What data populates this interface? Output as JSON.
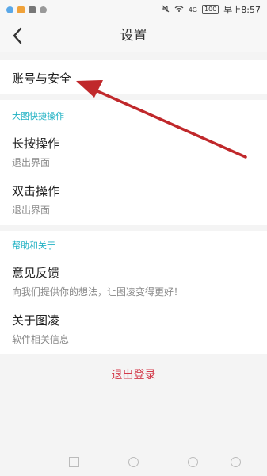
{
  "status_bar": {
    "time": "早上8:57",
    "battery": "100",
    "network": "4G"
  },
  "header": {
    "title": "设置",
    "back_icon": "chevron-left-icon"
  },
  "account": {
    "label": "账号与安全"
  },
  "quick_ops": {
    "header": "大图快捷操作",
    "items": [
      {
        "title": "长按操作",
        "value": "退出界面"
      },
      {
        "title": "双击操作",
        "value": "退出界面"
      }
    ]
  },
  "help": {
    "header": "帮助和关于",
    "items": [
      {
        "title": "意见反馈",
        "subtitle": "向我们提供你的想法，让图凌变得更好！"
      },
      {
        "title": "关于图凌",
        "subtitle": "软件相关信息"
      }
    ]
  },
  "logout": {
    "label": "退出登录"
  },
  "colors": {
    "accent": "#22b2c4",
    "danger": "#d33a4a",
    "annotation_arrow": "#c0282b"
  }
}
